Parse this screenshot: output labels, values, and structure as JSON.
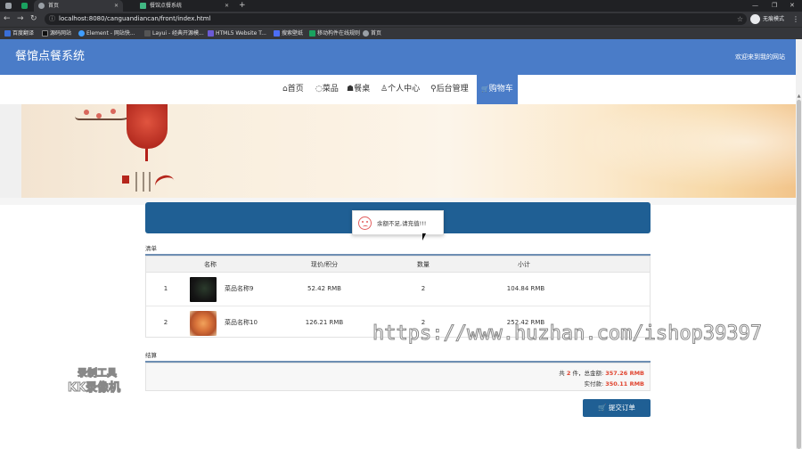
{
  "browser": {
    "tabs": [
      {
        "label": "首页",
        "active": true
      },
      {
        "label": "餐馆点餐系统",
        "active": false
      }
    ],
    "url": "localhost:8080/canguandiancan/front/index.html",
    "incognito_label": "无痕模式",
    "bookmarks": [
      "百度翻译",
      "源码网站",
      "Element - 网站快...",
      "Layui - 经典开源模...",
      "HTML5 Website T...",
      "搜索壁纸",
      "移动构件在线规则",
      "首页"
    ]
  },
  "header": {
    "site_title": "餐馆点餐系统",
    "welcome": "欢迎来到我的网站"
  },
  "nav": {
    "items": [
      {
        "icon": "home-icon",
        "glyph": "⌂",
        "label": "首页"
      },
      {
        "icon": "dish-icon",
        "glyph": "◌",
        "label": "菜品"
      },
      {
        "icon": "table-icon",
        "glyph": "☗",
        "label": "餐桌"
      },
      {
        "icon": "user-icon",
        "glyph": "♙",
        "label": "个人中心"
      },
      {
        "icon": "link-icon",
        "glyph": "⚲",
        "label": "后台管理"
      },
      {
        "icon": "cart-icon",
        "glyph": "🛒",
        "label": "购物车"
      }
    ],
    "active_index": 5
  },
  "notice": {
    "text": "余额不足,请充值!!!"
  },
  "cart": {
    "section_title": "清单",
    "columns": [
      "名称",
      "现价/积分",
      "数量",
      "小计"
    ],
    "rows": [
      {
        "index": "1",
        "name": "菜品名称9",
        "price": "52.42 RMB",
        "qty": "2",
        "subtotal": "104.84 RMB"
      },
      {
        "index": "2",
        "name": "菜品名称10",
        "price": "126.21 RMB",
        "qty": "2",
        "subtotal": "252.42 RMB"
      }
    ]
  },
  "checkout": {
    "section_title": "结算",
    "count_prefix": "共",
    "count": "2",
    "count_suffix": "件，总金额:",
    "total": "357.26 RMB",
    "paid_label": "实付款:",
    "paid": "350.11 RMB",
    "submit_label": "提交订单"
  },
  "overlay": {
    "watermark": "https://www.huzhan.com/ishop39397",
    "recorder_line1": "录制工具",
    "recorder_line2": "KK录像机"
  },
  "colors": {
    "header_blue": "#4a7cc8",
    "dark_blue": "#1f5f94",
    "price_red": "#e0442f"
  }
}
